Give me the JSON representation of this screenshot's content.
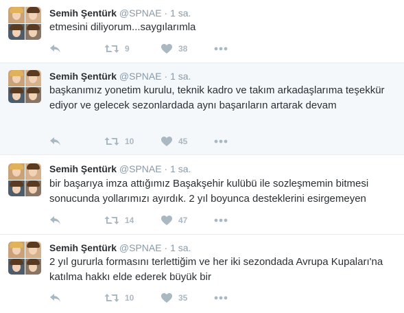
{
  "tweets": [
    {
      "name": "Semih Şentürk",
      "handle": "@SPNAE",
      "separator": "·",
      "time": "1 sa.",
      "text": "etmesini diliyorum...saygılarımla",
      "retweets": "9",
      "likes": "38",
      "highlighted": false
    },
    {
      "name": "Semih Şentürk",
      "handle": "@SPNAE",
      "separator": "·",
      "time": "1 sa.",
      "text": "başkanımız yonetim kurulu, teknik kadro ve takım arkadaşlarıma teşekkür ediyor ve gelecek sezonlardada aynı başarıların artarak devam",
      "retweets": "10",
      "likes": "45",
      "highlighted": true
    },
    {
      "name": "Semih Şentürk",
      "handle": "@SPNAE",
      "separator": "·",
      "time": "1 sa.",
      "text": "bir başarıya imza attığımız Başakşehir kulübü ile sozleşmemin bitmesi sonucunda yollarımızı ayırdık. 2 yıl boyunca desteklerini esirgemeyen",
      "retweets": "14",
      "likes": "47",
      "highlighted": false
    },
    {
      "name": "Semih Şentürk",
      "handle": "@SPNAE",
      "separator": "·",
      "time": "1 sa.",
      "text": "2 yıl gururla formasını terlettiğim ve her iki sezondada Avrupa Kupaları'na katılma hakkı elde ederek büyük bir",
      "retweets": "10",
      "likes": "35",
      "highlighted": false
    }
  ],
  "icons": {
    "reply": "reply-icon",
    "retweet": "retweet-icon",
    "like": "heart-icon",
    "more": "more-icon"
  },
  "colors": {
    "text": "#292f33",
    "muted": "#8899a6",
    "icon": "#aab8c2",
    "highlight_bg": "#f5f8fa",
    "divider": "#e6ecf0"
  }
}
